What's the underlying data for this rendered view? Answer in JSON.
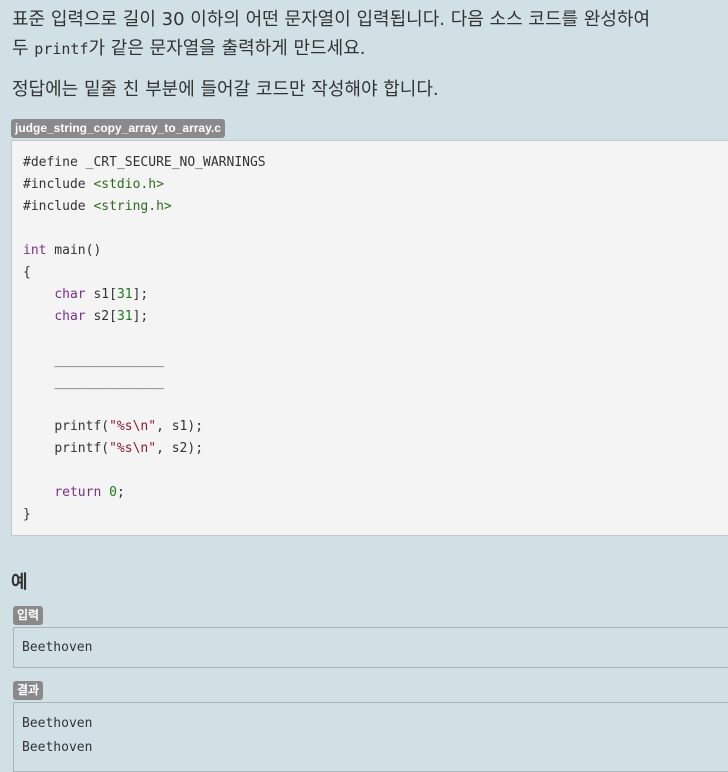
{
  "instructions": {
    "line1": "표준 입력으로 길이 30 이하의 어떤 문자열이 입력됩니다. 다음 소스 코드를 완성하여",
    "line2_before": "두 ",
    "line2_code": "printf",
    "line2_after": "가 같은 문자열을 출력하게 만드세요.",
    "line3": "정답에는 밑줄 친 부분에 들어갈 코드만 작성해야 합니다."
  },
  "file_name": "judge_string_copy_array_to_array.c",
  "code": {
    "define_kw": "#define",
    "define_val": " _CRT_SECURE_NO_WARNINGS",
    "include1_kw": "#include",
    "include1_val": "<stdio.h>",
    "include2_kw": "#include",
    "include2_val": "<string.h>",
    "main_type": "int",
    "main_sig": " main()",
    "open_brace": "{",
    "char_kw": "char",
    "s1_decl": " s1[",
    "s1_size": "31",
    "s2_decl": " s2[",
    "s2_size": "31",
    "decl_end": "];",
    "blank1": "______________",
    "blank2": "______________",
    "printf1_fn": "printf(",
    "printf1_fmt": "\"%s\\n\"",
    "printf1_args": ", s1);",
    "printf2_fn": "printf(",
    "printf2_fmt": "\"%s\\n\"",
    "printf2_args": ", s2);",
    "return_kw": "return",
    "return_val": "0",
    "return_end": ";",
    "close_brace": "}"
  },
  "example": {
    "heading": "예",
    "input_label": "입력",
    "input_lines": [
      "Beethoven"
    ],
    "result_label": "결과",
    "result_lines": [
      "Beethoven",
      "Beethoven"
    ]
  },
  "colors": {
    "background": "#d1e0e5",
    "keyword": "#7a2f8a",
    "string": "#8b1c2a",
    "number": "#1a7a1a",
    "badge": "#8a8a8a"
  }
}
